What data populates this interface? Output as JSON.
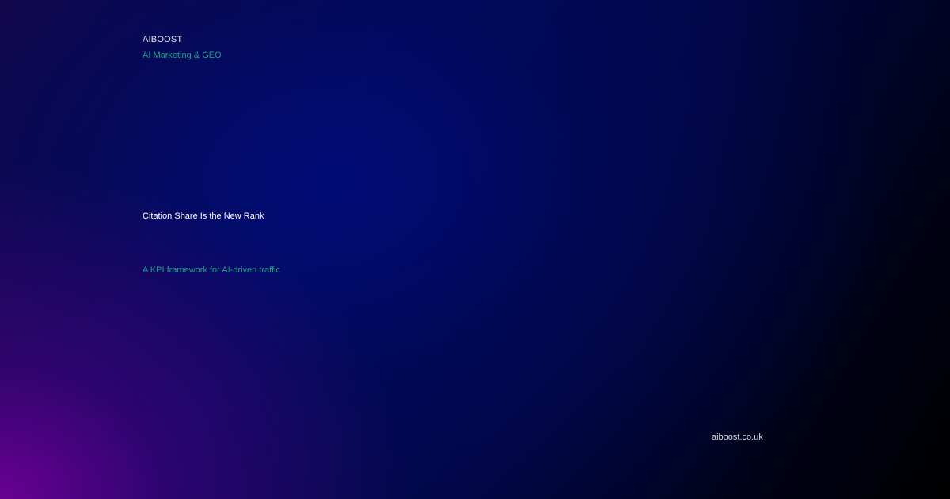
{
  "header": {
    "brand": "AIBOOST",
    "tagline": "AI Marketing & GEO"
  },
  "main": {
    "title": "Citation Share Is the New Rank",
    "subtitle": "A KPI framework for AI-driven traffic"
  },
  "footer": {
    "domain": "aiboost.co.uk"
  },
  "colors": {
    "accent": "#1f9f86",
    "text": "#ffffff",
    "background_dark": "#000000",
    "background_blue": "#020a5a",
    "background_purple": "#6e0096"
  }
}
